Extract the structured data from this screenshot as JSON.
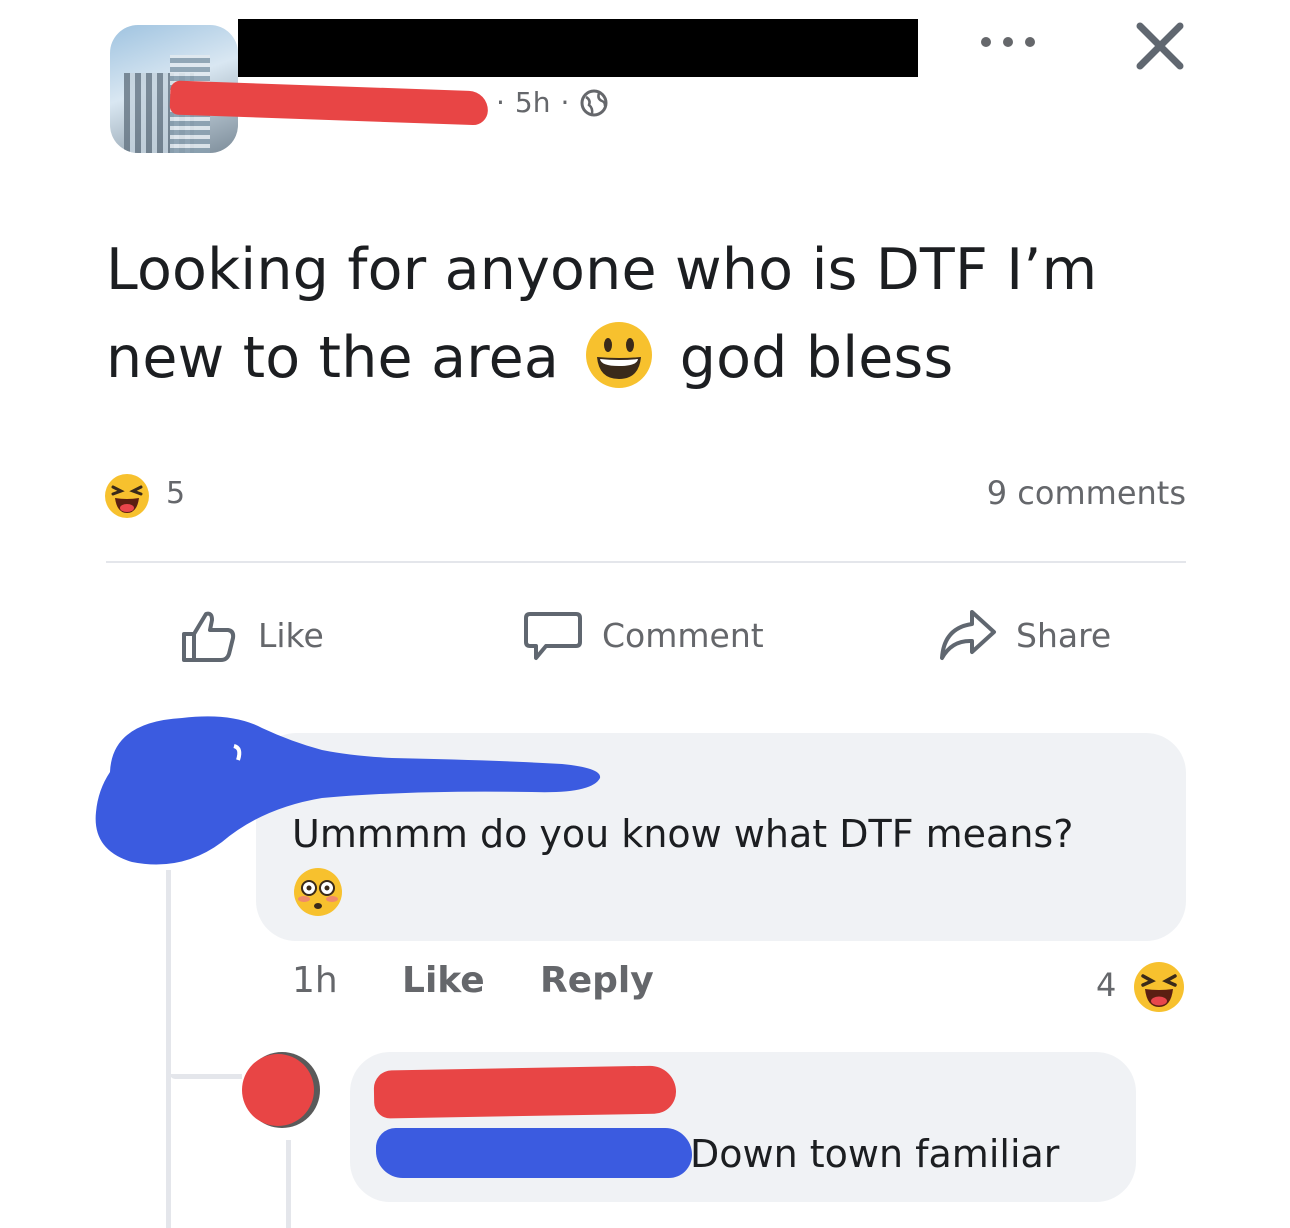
{
  "post": {
    "time": "5h",
    "separator": "·",
    "text_line1": "Looking for anyone who is DTF I’m",
    "text_line2_a": "new to the area",
    "text_line2_b": "god bless",
    "reaction_count": "5",
    "comments_count": "9 comments",
    "reaction_icon": "laughing-face-icon",
    "inline_emoji": "grinning-face-icon"
  },
  "actions": {
    "like": "Like",
    "comment": "Comment",
    "share": "Share"
  },
  "comment1": {
    "text": "Ummmm do you know what DTF means?",
    "emoji": "flushed-face-icon",
    "time": "1h",
    "like": "Like",
    "reply": "Reply",
    "reaction_count": "4"
  },
  "comment2": {
    "text": "Down town familiar"
  },
  "colors": {
    "meta_gray": "#65676b",
    "bubble_bg": "#f0f2f5",
    "redaction_red": "#e84545",
    "redaction_blue": "#3b5be0"
  }
}
